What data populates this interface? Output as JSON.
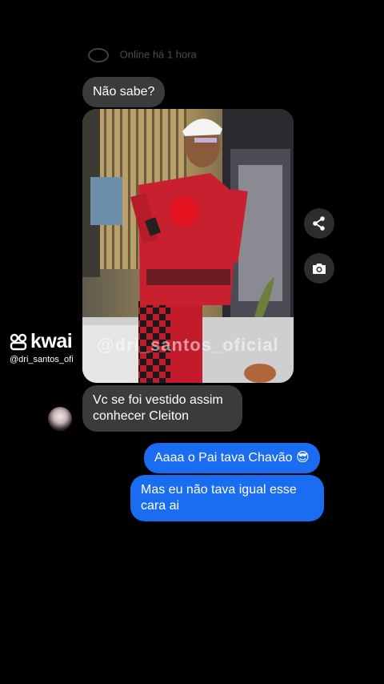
{
  "header": {
    "status_text": "Online há 1 hora"
  },
  "messages": {
    "m1": "Não sabe?",
    "m2": "Vc se foi vestido assim conhecer Cleiton",
    "m3": "Aaaa o Pai tava Chavão 😎",
    "m4": "Mas eu não tava igual esse cara ai"
  },
  "photo": {
    "watermark": "@dri_santos_oficial"
  },
  "overlay": {
    "brand": "kwai",
    "username": "@dri_santos_ofi"
  },
  "colors": {
    "incoming_bubble": "#3a3b3c",
    "outgoing_bubble": "#1a6df0",
    "background": "#000000"
  },
  "icons": {
    "share": "share-icon",
    "camera": "camera-icon"
  }
}
